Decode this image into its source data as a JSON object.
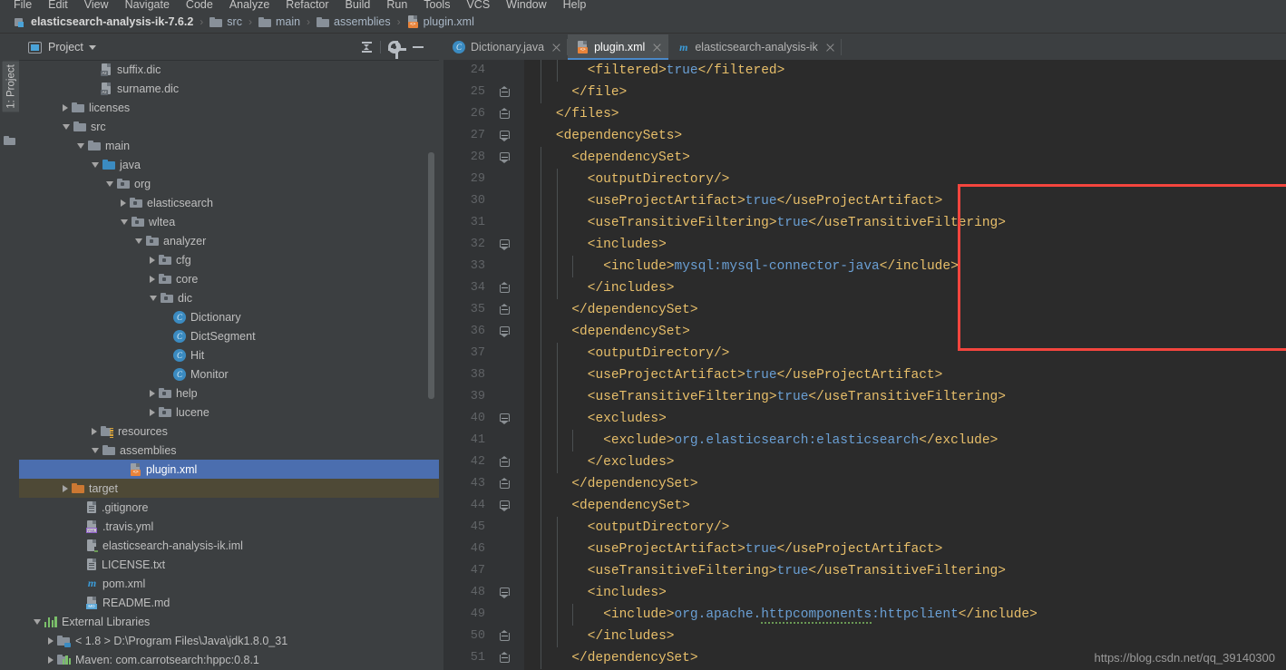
{
  "menu": {
    "items": [
      "File",
      "Edit",
      "View",
      "Navigate",
      "Code",
      "Analyze",
      "Refactor",
      "Build",
      "Run",
      "Tools",
      "VCS",
      "Window",
      "Help"
    ]
  },
  "breadcrumb": {
    "items": [
      {
        "label": "elasticsearch-analysis-ik-7.6.2",
        "icon": "module-icon"
      },
      {
        "label": "src",
        "icon": "folder-icon"
      },
      {
        "label": "main",
        "icon": "folder-icon"
      },
      {
        "label": "assemblies",
        "icon": "folder-icon"
      },
      {
        "label": "plugin.xml",
        "icon": "xml-file-icon"
      }
    ],
    "separator": "›"
  },
  "tool_window": {
    "vertical_tab": "1: Project",
    "title": "Project",
    "buttons": [
      "collapse-all-button",
      "settings-gear-button",
      "hide-button"
    ]
  },
  "tree": {
    "rows": [
      {
        "label": "suffix.dic",
        "indent": 5,
        "arrow": "none",
        "icon": "dic-file-icon",
        "badge": "Az",
        "state": "normal"
      },
      {
        "label": "surname.dic",
        "indent": 5,
        "arrow": "none",
        "icon": "dic-file-icon",
        "badge": "Az",
        "state": "normal"
      },
      {
        "label": "licenses",
        "indent": 3,
        "arrow": "closed",
        "icon": "folder-icon",
        "state": "normal"
      },
      {
        "label": "src",
        "indent": 3,
        "arrow": "open",
        "icon": "folder-icon",
        "state": "normal"
      },
      {
        "label": "main",
        "indent": 4,
        "arrow": "open",
        "icon": "folder-icon",
        "state": "normal"
      },
      {
        "label": "java",
        "indent": 5,
        "arrow": "open",
        "icon": "source-folder-icon",
        "state": "normal"
      },
      {
        "label": "org",
        "indent": 6,
        "arrow": "open",
        "icon": "package-icon",
        "state": "normal"
      },
      {
        "label": "elasticsearch",
        "indent": 7,
        "arrow": "closed",
        "icon": "package-icon",
        "state": "normal"
      },
      {
        "label": "wltea",
        "indent": 7,
        "arrow": "open",
        "icon": "package-icon",
        "state": "normal"
      },
      {
        "label": "analyzer",
        "indent": 8,
        "arrow": "open",
        "icon": "package-icon",
        "state": "normal"
      },
      {
        "label": "cfg",
        "indent": 9,
        "arrow": "closed",
        "icon": "package-icon",
        "state": "normal"
      },
      {
        "label": "core",
        "indent": 9,
        "arrow": "closed",
        "icon": "package-icon",
        "state": "normal"
      },
      {
        "label": "dic",
        "indent": 9,
        "arrow": "open",
        "icon": "package-icon",
        "state": "normal"
      },
      {
        "label": "Dictionary",
        "indent": 10,
        "arrow": "none",
        "icon": "java-class-icon",
        "state": "normal"
      },
      {
        "label": "DictSegment",
        "indent": 10,
        "arrow": "none",
        "icon": "java-class-icon",
        "state": "normal"
      },
      {
        "label": "Hit",
        "indent": 10,
        "arrow": "none",
        "icon": "java-class-icon",
        "state": "normal"
      },
      {
        "label": "Monitor",
        "indent": 10,
        "arrow": "none",
        "icon": "java-class-icon",
        "state": "normal"
      },
      {
        "label": "help",
        "indent": 9,
        "arrow": "closed",
        "icon": "package-icon",
        "state": "normal"
      },
      {
        "label": "lucene",
        "indent": 9,
        "arrow": "closed",
        "icon": "package-icon",
        "state": "normal"
      },
      {
        "label": "resources",
        "indent": 5,
        "arrow": "closed",
        "icon": "resources-folder-icon",
        "state": "normal"
      },
      {
        "label": "assemblies",
        "indent": 5,
        "arrow": "open",
        "icon": "folder-icon",
        "state": "normal"
      },
      {
        "label": "plugin.xml",
        "indent": 7,
        "arrow": "none",
        "icon": "xml-file-icon",
        "state": "selected"
      },
      {
        "label": "target",
        "indent": 3,
        "arrow": "closed",
        "icon": "excluded-folder-icon",
        "state": "target"
      },
      {
        "label": ".gitignore",
        "indent": 4,
        "arrow": "none",
        "icon": "text-file-icon",
        "state": "normal"
      },
      {
        "label": ".travis.yml",
        "indent": 4,
        "arrow": "none",
        "icon": "yaml-file-icon",
        "badge": "YML",
        "state": "normal"
      },
      {
        "label": "elasticsearch-analysis-ik.iml",
        "indent": 4,
        "arrow": "none",
        "icon": "iml-file-icon",
        "state": "normal"
      },
      {
        "label": "LICENSE.txt",
        "indent": 4,
        "arrow": "none",
        "icon": "text-file-icon",
        "state": "normal"
      },
      {
        "label": "pom.xml",
        "indent": 4,
        "arrow": "none",
        "icon": "maven-file-icon",
        "state": "normal"
      },
      {
        "label": "README.md",
        "indent": 4,
        "arrow": "none",
        "icon": "markdown-file-icon",
        "badge": "MD",
        "state": "normal"
      },
      {
        "label": "External Libraries",
        "indent": 1,
        "arrow": "open",
        "icon": "libraries-icon",
        "state": "normal"
      },
      {
        "label": "< 1.8 >  D:\\Program Files\\Java\\jdk1.8.0_31",
        "indent": 2,
        "arrow": "closed",
        "icon": "jdk-icon",
        "state": "normal"
      },
      {
        "label": "Maven: com.carrotsearch:hppc:0.8.1",
        "indent": 2,
        "arrow": "closed",
        "icon": "maven-library-icon",
        "state": "normal"
      }
    ]
  },
  "editor": {
    "tabs": [
      {
        "label": "Dictionary.java",
        "icon": "java-class-icon",
        "active": false
      },
      {
        "label": "plugin.xml",
        "icon": "xml-file-icon",
        "active": true
      },
      {
        "label": "elasticsearch-analysis-ik",
        "icon": "maven-file-icon",
        "active": false
      }
    ],
    "first_line_number": 24,
    "lines": [
      {
        "n": 24,
        "fold": "none",
        "indent": 8,
        "spans": [
          {
            "c": "t",
            "s": "<filtered>"
          },
          {
            "c": "v",
            "s": "true"
          },
          {
            "c": "t",
            "s": "</filtered>"
          }
        ]
      },
      {
        "n": 25,
        "fold": "end",
        "indent": 6,
        "spans": [
          {
            "c": "t",
            "s": "</file>"
          }
        ]
      },
      {
        "n": 26,
        "fold": "end",
        "indent": 4,
        "spans": [
          {
            "c": "t",
            "s": "</files>"
          }
        ]
      },
      {
        "n": 27,
        "fold": "top",
        "indent": 4,
        "spans": [
          {
            "c": "t",
            "s": "<dependencySets>"
          }
        ]
      },
      {
        "n": 28,
        "fold": "top",
        "indent": 6,
        "spans": [
          {
            "c": "t",
            "s": "<dependencySet>"
          }
        ]
      },
      {
        "n": 29,
        "fold": "none",
        "indent": 8,
        "spans": [
          {
            "c": "t",
            "s": "<outputDirectory/>"
          }
        ]
      },
      {
        "n": 30,
        "fold": "none",
        "indent": 8,
        "spans": [
          {
            "c": "t",
            "s": "<useProjectArtifact>"
          },
          {
            "c": "v",
            "s": "true"
          },
          {
            "c": "t",
            "s": "</useProjectArtifact>"
          }
        ]
      },
      {
        "n": 31,
        "fold": "none",
        "indent": 8,
        "spans": [
          {
            "c": "t",
            "s": "<useTransitiveFiltering>"
          },
          {
            "c": "v",
            "s": "true"
          },
          {
            "c": "t",
            "s": "</useTransitiveFiltering>"
          }
        ]
      },
      {
        "n": 32,
        "fold": "top",
        "indent": 8,
        "spans": [
          {
            "c": "t",
            "s": "<includes>"
          }
        ]
      },
      {
        "n": 33,
        "fold": "none",
        "indent": 10,
        "spans": [
          {
            "c": "t",
            "s": "<include>"
          },
          {
            "c": "v",
            "s": "mysql:mysql-connector-java"
          },
          {
            "c": "t",
            "s": "</include>"
          }
        ]
      },
      {
        "n": 34,
        "fold": "end",
        "indent": 8,
        "spans": [
          {
            "c": "t",
            "s": "</includes>"
          }
        ]
      },
      {
        "n": 35,
        "fold": "end",
        "indent": 6,
        "spans": [
          {
            "c": "t",
            "s": "</dependencySet>"
          }
        ]
      },
      {
        "n": 36,
        "fold": "top",
        "indent": 6,
        "spans": [
          {
            "c": "t",
            "s": "<dependencySet>"
          }
        ]
      },
      {
        "n": 37,
        "fold": "none",
        "indent": 8,
        "spans": [
          {
            "c": "t",
            "s": "<outputDirectory/>"
          }
        ]
      },
      {
        "n": 38,
        "fold": "none",
        "indent": 8,
        "spans": [
          {
            "c": "t",
            "s": "<useProjectArtifact>"
          },
          {
            "c": "v",
            "s": "true"
          },
          {
            "c": "t",
            "s": "</useProjectArtifact>"
          }
        ]
      },
      {
        "n": 39,
        "fold": "none",
        "indent": 8,
        "spans": [
          {
            "c": "t",
            "s": "<useTransitiveFiltering>"
          },
          {
            "c": "v",
            "s": "true"
          },
          {
            "c": "t",
            "s": "</useTransitiveFiltering>"
          }
        ]
      },
      {
        "n": 40,
        "fold": "top",
        "indent": 8,
        "spans": [
          {
            "c": "t",
            "s": "<excludes>"
          }
        ]
      },
      {
        "n": 41,
        "fold": "none",
        "indent": 10,
        "spans": [
          {
            "c": "t",
            "s": "<exclude>"
          },
          {
            "c": "v",
            "s": "org.elasticsearch:elasticsearch"
          },
          {
            "c": "t",
            "s": "</exclude>"
          }
        ]
      },
      {
        "n": 42,
        "fold": "end",
        "indent": 8,
        "spans": [
          {
            "c": "t",
            "s": "</excludes>"
          }
        ]
      },
      {
        "n": 43,
        "fold": "end",
        "indent": 6,
        "spans": [
          {
            "c": "t",
            "s": "</dependencySet>"
          }
        ]
      },
      {
        "n": 44,
        "fold": "top",
        "indent": 6,
        "spans": [
          {
            "c": "t",
            "s": "<dependencySet>"
          }
        ]
      },
      {
        "n": 45,
        "fold": "none",
        "indent": 8,
        "spans": [
          {
            "c": "t",
            "s": "<outputDirectory/>"
          }
        ]
      },
      {
        "n": 46,
        "fold": "none",
        "indent": 8,
        "spans": [
          {
            "c": "t",
            "s": "<useProjectArtifact>"
          },
          {
            "c": "v",
            "s": "true"
          },
          {
            "c": "t",
            "s": "</useProjectArtifact>"
          }
        ]
      },
      {
        "n": 47,
        "fold": "none",
        "indent": 8,
        "spans": [
          {
            "c": "t",
            "s": "<useTransitiveFiltering>"
          },
          {
            "c": "v",
            "s": "true"
          },
          {
            "c": "t",
            "s": "</useTransitiveFiltering>"
          }
        ]
      },
      {
        "n": 48,
        "fold": "top",
        "indent": 8,
        "spans": [
          {
            "c": "t",
            "s": "<includes>"
          }
        ]
      },
      {
        "n": 49,
        "fold": "none",
        "indent": 10,
        "spans": [
          {
            "c": "t",
            "s": "<include>"
          },
          {
            "c": "v",
            "s": "org.apache."
          },
          {
            "c": "v sq",
            "s": "httpcomponents"
          },
          {
            "c": "v",
            "s": ":httpclient"
          },
          {
            "c": "t",
            "s": "</include>"
          }
        ]
      },
      {
        "n": 50,
        "fold": "end",
        "indent": 8,
        "spans": [
          {
            "c": "t",
            "s": "</includes>"
          }
        ]
      },
      {
        "n": 51,
        "fold": "end",
        "indent": 6,
        "spans": [
          {
            "c": "t",
            "s": "</dependencySet>"
          }
        ]
      }
    ]
  },
  "annotation": {
    "highlight_box": {
      "from_line": 28,
      "to_line": 35,
      "color": "#f4453e"
    }
  },
  "watermark": "https://blog.csdn.net/qq_39140300",
  "colors": {
    "panel_bg": "#3c3f41",
    "editor_bg": "#2b2b2b",
    "gutter_bg": "#313335",
    "selection_blue": "#4b6eaf",
    "tag_orange": "#e8bf6a",
    "value_blue": "#6a9fd4",
    "accent_red": "#f4453e"
  }
}
